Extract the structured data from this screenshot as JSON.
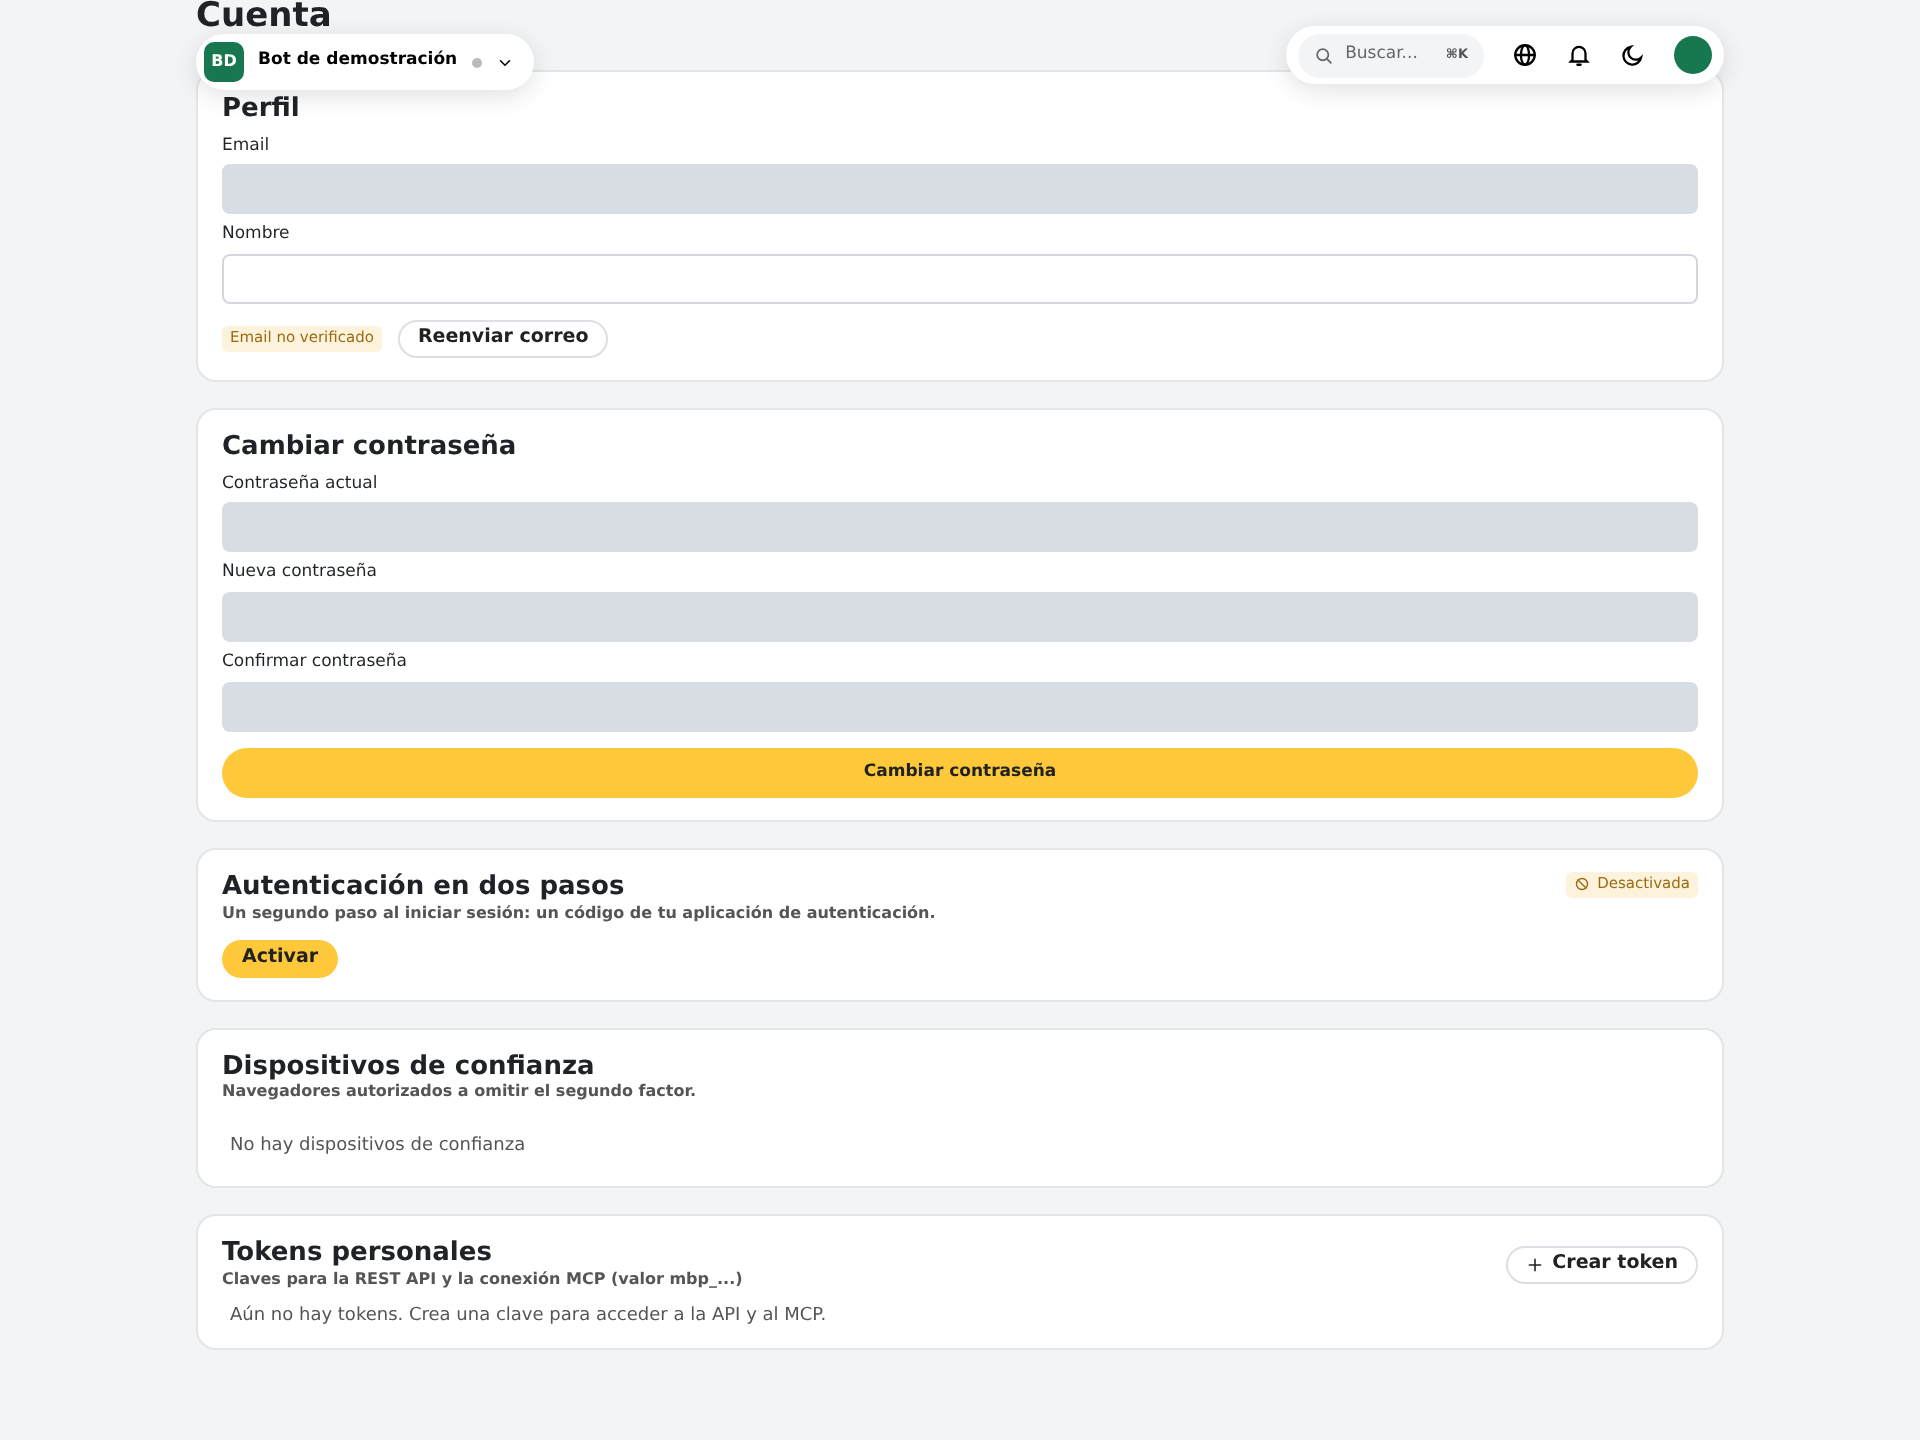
{
  "page_title": "Cuenta",
  "workspace": {
    "initials": "BD",
    "name": "Bot de demostración"
  },
  "toolbar": {
    "search_placeholder": "Buscar...",
    "shortcut": "⌘K"
  },
  "profile": {
    "title": "Perfil",
    "fields": [
      {
        "label": "Email",
        "disabled": true
      },
      {
        "label": "Nombre",
        "disabled": false
      }
    ],
    "badge": "Email no verificado",
    "button": "Reenviar correo"
  },
  "password": {
    "title": "Cambiar contraseña",
    "fields": [
      {
        "label": "Contraseña actual",
        "disabled": true
      },
      {
        "label": "Nueva contraseña",
        "disabled": true
      },
      {
        "label": "Confirmar contraseña",
        "disabled": true
      }
    ],
    "button": "Cambiar contraseña"
  },
  "two_factor": {
    "title": "Autenticación en dos pasos",
    "subtitle": "Un segundo paso al iniciar sesión: un código de tu aplicación de autenticación.",
    "enabled": false,
    "status": "Desactivada",
    "button": "Activar"
  },
  "devices": {
    "title": "Dispositivos de confianza",
    "subtitle": "Navegadores autorizados a omitir el segundo factor.",
    "empty": "No hay dispositivos de confianza"
  },
  "tokens": {
    "title": "Tokens personales",
    "subtitle": "Claves para la REST API y la conexión MCP (valor mbp_...)",
    "button": "Crear token",
    "empty": "Aún no hay tokens. Crea una clave para acceder a la API y al MCP."
  }
}
